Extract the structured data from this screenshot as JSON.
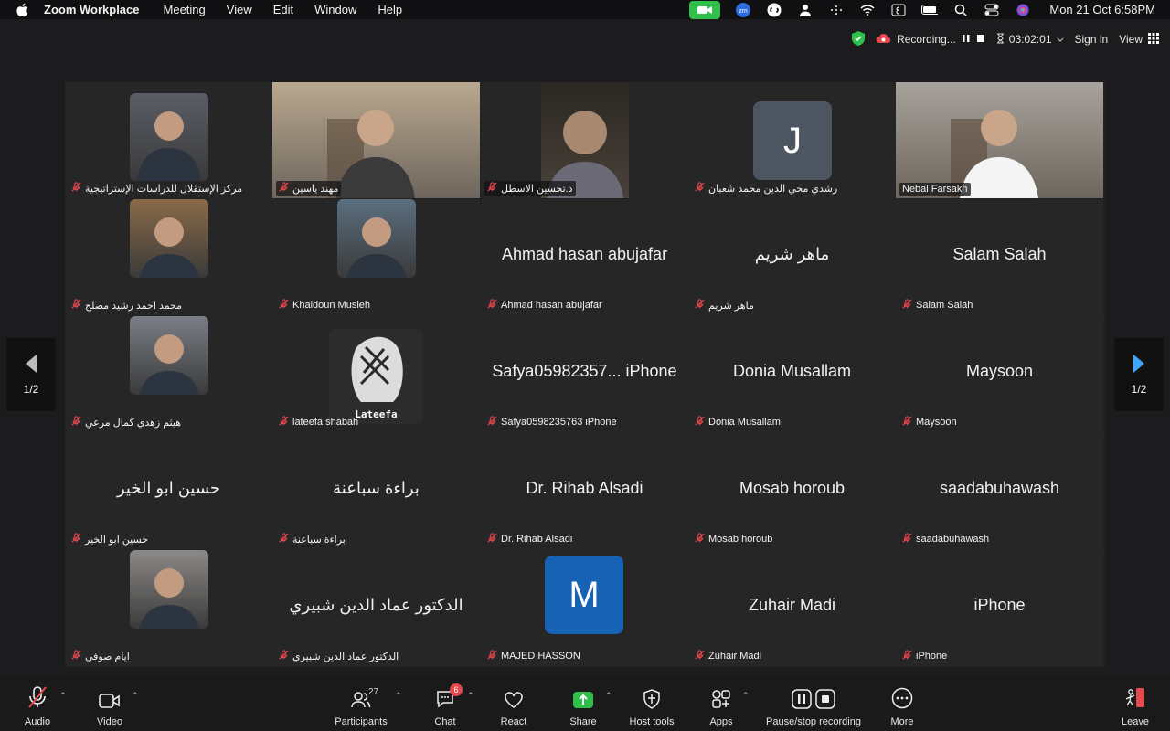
{
  "menubar": {
    "app_name": "Zoom Workplace",
    "items": [
      "Meeting",
      "View",
      "Edit",
      "Window",
      "Help"
    ],
    "clock": "Mon 21 Oct  6:58PM",
    "zoom_badge": "zm"
  },
  "topbar": {
    "recording_label": "Recording...",
    "timer": "03:02:01",
    "sign_in": "Sign in",
    "view": "View"
  },
  "pager": {
    "left_label": "1/2",
    "right_label": "1/2"
  },
  "tiles": [
    {
      "name": "مركز الإستقلال للدراسات الإستراتيجية",
      "big": "",
      "type": "photo",
      "bg": "#5a5d66"
    },
    {
      "name": "مهند ياسين",
      "big": "",
      "type": "video",
      "bg": "#b9a88f"
    },
    {
      "name": "د.تحسين الاسطل",
      "big": "",
      "type": "photo-tall",
      "bg": "#3a3530"
    },
    {
      "name": "رشدي محي الدين محمد شعبان",
      "big": "",
      "type": "letter",
      "letter": "J",
      "bg": "#4d5660"
    },
    {
      "name": "Nebal Farsakh",
      "big": "",
      "type": "video-active",
      "bg": "#a7a39c"
    },
    {
      "name": "محمد احمد رشيد مصلح",
      "big": "",
      "type": "photo",
      "bg": "#8a6a48"
    },
    {
      "name": "Khaldoun Musleh",
      "big": "",
      "type": "photo",
      "bg": "#5b6f7f"
    },
    {
      "name": "Ahmad hasan abujafar",
      "big": "Ahmad hasan abujafar",
      "type": "text"
    },
    {
      "name": "ماهر شريم",
      "big": "ماهر شريم",
      "type": "text"
    },
    {
      "name": "Salam Salah",
      "big": "Salam Salah",
      "type": "text"
    },
    {
      "name": "هيثم زهدي كمال مرعي",
      "big": "",
      "type": "photo",
      "bg": "#7a7e86"
    },
    {
      "name": "lateefa shabah",
      "big": "",
      "type": "photo-lateefa",
      "bg": "#2a2a2a",
      "caption": "Lateefa"
    },
    {
      "name": "Safya0598235763 iPhone",
      "big": "Safya05982357... iPhone",
      "type": "text"
    },
    {
      "name": "Donia Musallam",
      "big": "Donia Musallam",
      "type": "text"
    },
    {
      "name": "Maysoon",
      "big": "Maysoon",
      "type": "text"
    },
    {
      "name": "حسين ابو الخير",
      "big": "حسين ابو الخير",
      "type": "text"
    },
    {
      "name": "براءة سباعنة",
      "big": "براءة سباعنة",
      "type": "text"
    },
    {
      "name": "Dr. Rihab Alsadi",
      "big": "Dr. Rihab Alsadi",
      "type": "text"
    },
    {
      "name": "Mosab horoub",
      "big": "Mosab horoub",
      "type": "text"
    },
    {
      "name": "saadabuhawash",
      "big": "saadabuhawash",
      "type": "text"
    },
    {
      "name": "ايام صوفي",
      "big": "",
      "type": "photo",
      "bg": "#8c8a88"
    },
    {
      "name": "الدكتور عماد الدين شبيري",
      "big": "الدكتور عماد الدين شبيري",
      "type": "text"
    },
    {
      "name": "MAJED HASSON",
      "big": "",
      "type": "letter",
      "letter": "M",
      "bg": "#1762b5"
    },
    {
      "name": "Zuhair Madi",
      "big": "Zuhair Madi",
      "type": "text"
    },
    {
      "name": "iPhone",
      "big": "iPhone",
      "type": "text"
    }
  ],
  "toolbar": {
    "audio": "Audio",
    "video": "Video",
    "participants": "Participants",
    "participants_count": "27",
    "chat": "Chat",
    "chat_badge": "6",
    "react": "React",
    "share": "Share",
    "host_tools": "Host tools",
    "apps": "Apps",
    "pause_stop": "Pause/stop recording",
    "more": "More",
    "leave": "Leave"
  },
  "colors": {
    "active_speaker": "#2fca4b",
    "share_green": "#2fbf4a",
    "mute_red": "#e5484d",
    "leave_red": "#e5484d"
  }
}
